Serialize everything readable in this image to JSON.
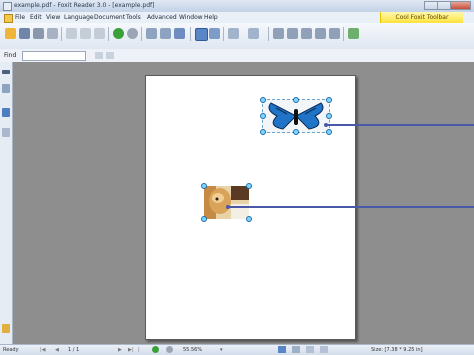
{
  "window": {
    "title": "example.pdf - Foxit Reader 3.0 - [example.pdf]"
  },
  "menu": {
    "items": [
      "File",
      "Edit",
      "View",
      "Language",
      "Document",
      "Tools",
      "Advanced",
      "Window",
      "Help"
    ],
    "cool_toolbar": "Cool Foxit Toolbar"
  },
  "find": {
    "label": "Find",
    "value": ""
  },
  "status": {
    "ready": "Ready",
    "page": "1 / 1",
    "zoom": "55.56%",
    "size": "Size: [7.38 * 9.25 in]"
  },
  "colors": {
    "accent": "#4a58a8",
    "toolbar_highlight": "#ffe23a",
    "doc_bg": "#8e8e8e"
  }
}
